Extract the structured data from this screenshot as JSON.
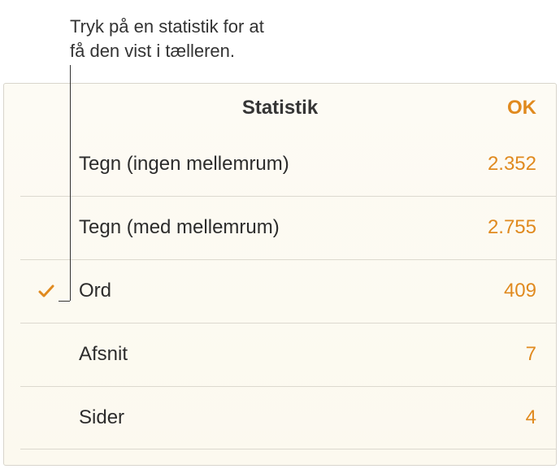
{
  "annotation": {
    "text": "Tryk på en statistik for at\nfå den vist i tælleren."
  },
  "panel": {
    "title": "Statistik",
    "ok_label": "OK"
  },
  "stats": [
    {
      "label": "Tegn (ingen mellemrum)",
      "value": "2.352",
      "selected": false
    },
    {
      "label": "Tegn (med mellemrum)",
      "value": "2.755",
      "selected": false
    },
    {
      "label": "Ord",
      "value": "409",
      "selected": true
    },
    {
      "label": "Afsnit",
      "value": "7",
      "selected": false
    },
    {
      "label": "Sider",
      "value": "4",
      "selected": false
    }
  ]
}
